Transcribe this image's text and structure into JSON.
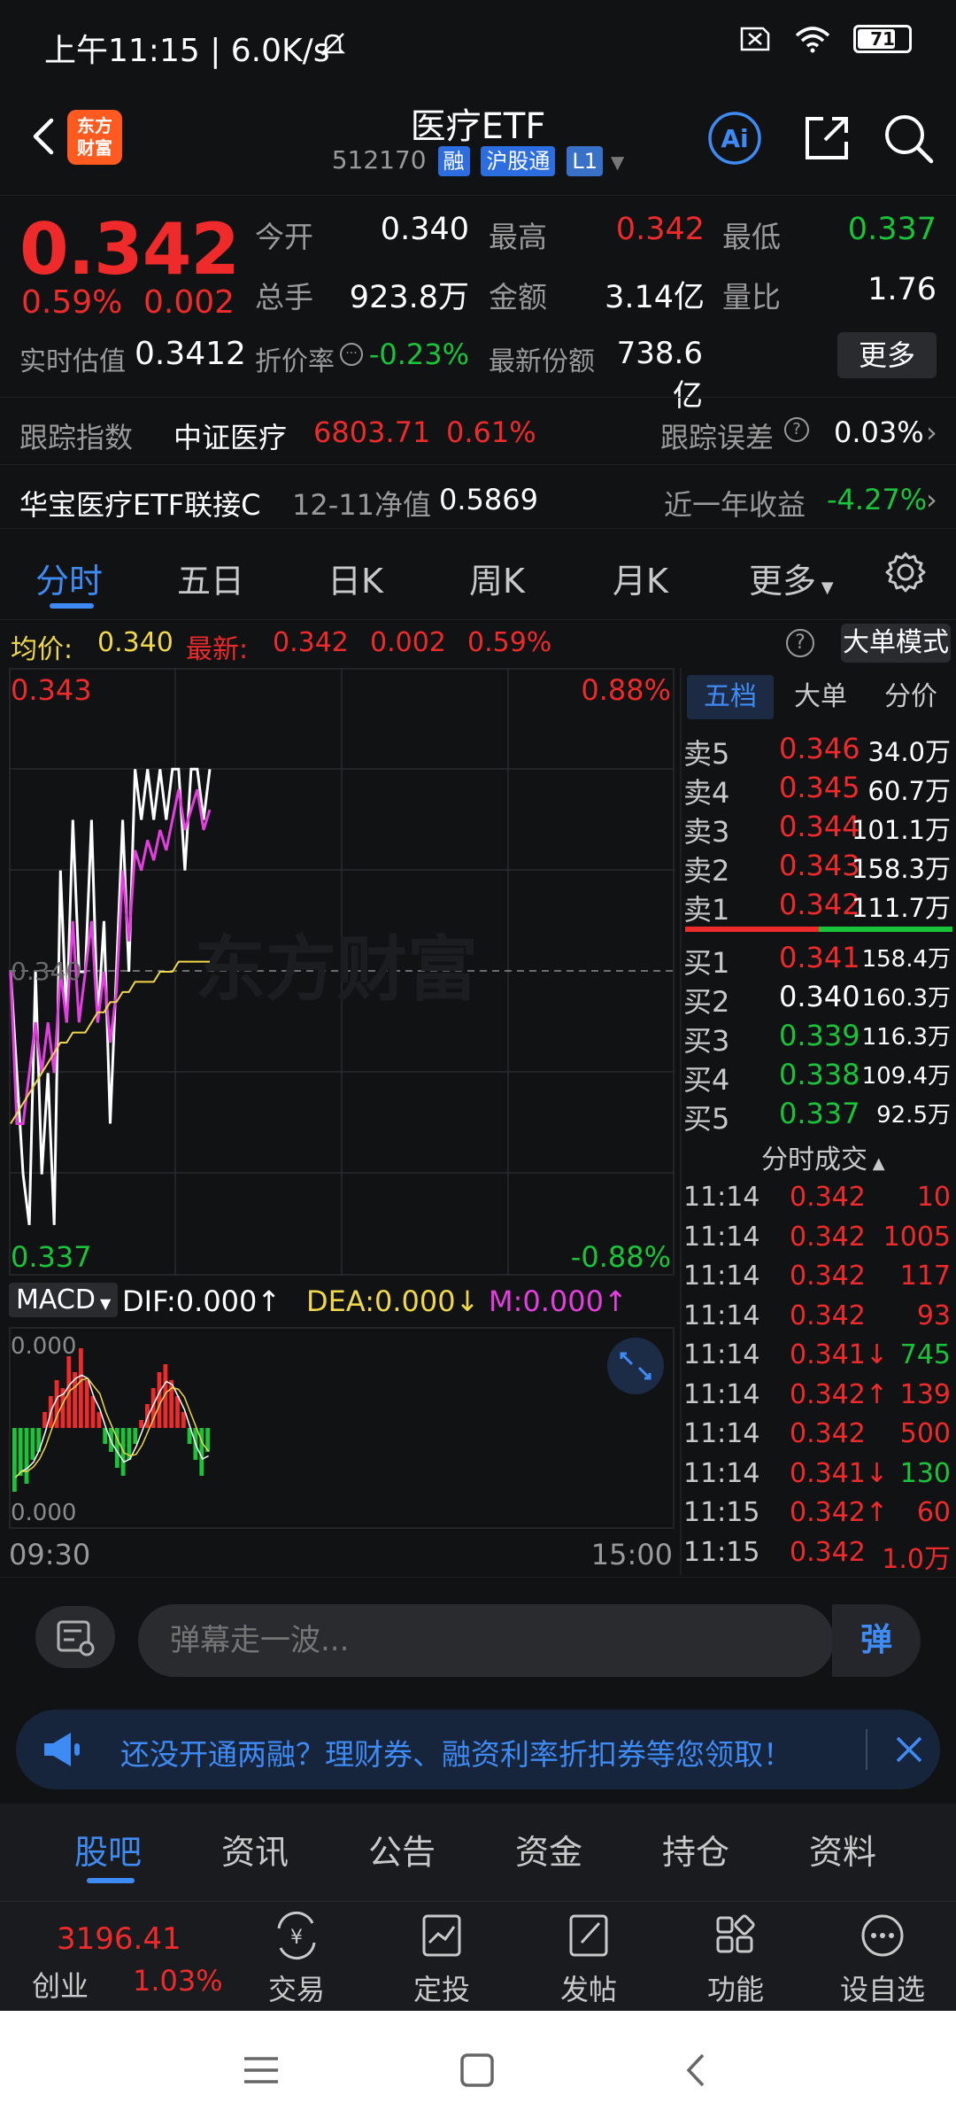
{
  "status": {
    "time": "上午11:15 | 6.0K/s",
    "battery": "71"
  },
  "header": {
    "logo_text": "东方\n财富",
    "title": "医疗ETF",
    "code": "512170",
    "tag_margin": "融",
    "tag_connect": "沪股通",
    "tag_level": "L1"
  },
  "quote": {
    "price": "0.342",
    "pct_change": "0.59%",
    "amt_change": "0.002",
    "open_label": "今开",
    "open": "0.340",
    "high_label": "最高",
    "high": "0.342",
    "low_label": "最低",
    "low": "0.337",
    "volume_label": "总手",
    "volume": "923.8万",
    "amount_label": "金额",
    "amount": "3.14亿",
    "ratio_label": "量比",
    "ratio": "1.76",
    "est_label": "实时估值",
    "est": "0.3412",
    "discount_label": "折价率",
    "discount": "-0.23%",
    "shares_label": "最新份额",
    "shares": "738.6亿",
    "more": "更多"
  },
  "tracking": {
    "index_label": "跟踪指数",
    "index_name": "中证医疗",
    "index_value": "6803.71",
    "index_pct": "0.61%",
    "error_label": "跟踪误差",
    "error_value": "0.03%",
    "link_fund": "华宝医疗ETF联接C",
    "nav_label": "12-11净值",
    "nav_value": "0.5869",
    "year_label": "近一年收益",
    "year_value": "-4.27%"
  },
  "chart_tabs": [
    "分时",
    "五日",
    "日K",
    "周K",
    "月K",
    "更多"
  ],
  "chart_info": {
    "avg_label": "均价:",
    "avg": "0.340",
    "latest_label": "最新:",
    "latest": "0.342",
    "chg": "0.002",
    "pct": "0.59%",
    "big_order": "大单模式"
  },
  "chart_labels": {
    "top_price": "0.343",
    "top_pct": "0.88%",
    "bottom_price": "0.337",
    "bottom_pct": "-0.88%",
    "ref_price": "0.340",
    "watermark": "东方财富",
    "start_time": "09:30",
    "end_time": "15:00"
  },
  "macd": {
    "name": "MACD",
    "dif": "DIF:0.000↑",
    "dea": "DEA:0.000↓",
    "m": "M:0.000↑",
    "top": "0.000",
    "bottom": "0.000"
  },
  "chart_data": [
    {
      "type": "line",
      "title": "",
      "ylim": [
        0.337,
        0.343
      ],
      "x": [
        "09:30",
        "15:00"
      ],
      "series": [
        {
          "name": "",
          "color": "#ffffff",
          "values": [
            0.34,
            0.339,
            0.338,
            0.3375,
            0.34,
            0.338,
            0.339,
            0.3375,
            0.341,
            0.3395,
            0.3415,
            0.34,
            0.34,
            0.3415,
            0.3395,
            0.3405,
            0.3385,
            0.34,
            0.3415,
            0.34,
            0.342,
            0.3415,
            0.342,
            0.3415,
            0.342,
            0.3415,
            0.342,
            0.342,
            0.341,
            0.342,
            0.342,
            0.3415,
            0.342
          ]
        },
        {
          "name": "",
          "color": "#e53ee0",
          "values": [
            0.34,
            0.3385,
            0.3385,
            0.339,
            0.3395,
            0.339,
            0.3395,
            0.339,
            0.34,
            0.3395,
            0.3405,
            0.3395,
            0.34,
            0.3405,
            0.3395,
            0.34,
            0.3393,
            0.3398,
            0.341,
            0.3403,
            0.3412,
            0.341,
            0.3413,
            0.3411,
            0.3414,
            0.3412,
            0.3415,
            0.3418,
            0.3414,
            0.3416,
            0.3418,
            0.3414,
            0.3416
          ]
        },
        {
          "name": "",
          "color": "#f1d84b",
          "values": [
            0.3385,
            0.3386,
            0.3387,
            0.3388,
            0.3389,
            0.339,
            0.3391,
            0.3392,
            0.3393,
            0.3393,
            0.3394,
            0.3394,
            0.3394,
            0.3395,
            0.3396,
            0.3396,
            0.3397,
            0.3397,
            0.3398,
            0.3398,
            0.3399,
            0.3399,
            0.3399,
            0.3399,
            0.34,
            0.34,
            0.34,
            0.3401,
            0.3401,
            0.3401,
            0.3401,
            0.3401,
            0.3401
          ]
        }
      ]
    },
    {
      "type": "bar",
      "title": "",
      "values": [
        -0.8,
        -0.6,
        -0.7,
        -0.4,
        -0.3,
        0.2,
        0.4,
        0.6,
        0.5,
        0.9,
        0.7,
        1.0,
        0.6,
        0.4,
        0.2,
        -0.2,
        -0.3,
        -0.5,
        -0.6,
        -0.4,
        -0.2,
        0.1,
        0.3,
        0.5,
        0.7,
        0.8,
        0.6,
        0.4,
        0.2,
        -0.2,
        -0.4,
        -0.6,
        -0.3
      ]
    }
  ],
  "orderbook": {
    "tabs": [
      "五档",
      "大单",
      "分价"
    ],
    "asks": [
      {
        "label": "卖5",
        "price": "0.346",
        "vol": "34.0万"
      },
      {
        "label": "卖4",
        "price": "0.345",
        "vol": "60.7万"
      },
      {
        "label": "卖3",
        "price": "0.344",
        "vol": "101.1万"
      },
      {
        "label": "卖2",
        "price": "0.343",
        "vol": "158.3万"
      },
      {
        "label": "卖1",
        "price": "0.342",
        "vol": "111.7万"
      }
    ],
    "bids": [
      {
        "label": "买1",
        "price": "0.341",
        "vol": "158.4万",
        "color": "#ef2a2a"
      },
      {
        "label": "买2",
        "price": "0.340",
        "vol": "160.3万",
        "color": "#ffffff"
      },
      {
        "label": "买3",
        "price": "0.339",
        "vol": "116.3万",
        "color": "#19c43a"
      },
      {
        "label": "买4",
        "price": "0.338",
        "vol": "109.4万",
        "color": "#19c43a"
      },
      {
        "label": "买5",
        "price": "0.337",
        "vol": "92.5万",
        "color": "#19c43a"
      }
    ],
    "ticks_title": "分时成交",
    "ticks": [
      {
        "time": "11:14",
        "price": "0.342",
        "vol": "10",
        "pcolor": "#ef2a2a",
        "vcolor": "#ef2a2a"
      },
      {
        "time": "11:14",
        "price": "0.342",
        "vol": "1005",
        "pcolor": "#ef2a2a",
        "vcolor": "#ef2a2a"
      },
      {
        "time": "11:14",
        "price": "0.342",
        "vol": "117",
        "pcolor": "#ef2a2a",
        "vcolor": "#ef2a2a"
      },
      {
        "time": "11:14",
        "price": "0.342",
        "vol": "93",
        "pcolor": "#ef2a2a",
        "vcolor": "#ef2a2a"
      },
      {
        "time": "11:14",
        "price": "0.341↓",
        "vol": "745",
        "pcolor": "#ef2a2a",
        "vcolor": "#19c43a"
      },
      {
        "time": "11:14",
        "price": "0.342↑",
        "vol": "139",
        "pcolor": "#ef2a2a",
        "vcolor": "#ef2a2a"
      },
      {
        "time": "11:14",
        "price": "0.342",
        "vol": "500",
        "pcolor": "#ef2a2a",
        "vcolor": "#ef2a2a"
      },
      {
        "time": "11:14",
        "price": "0.341↓",
        "vol": "130",
        "pcolor": "#ef2a2a",
        "vcolor": "#19c43a"
      },
      {
        "time": "11:15",
        "price": "0.342↑",
        "vol": "60",
        "pcolor": "#ef2a2a",
        "vcolor": "#ef2a2a"
      },
      {
        "time": "11:15",
        "price": "0.342",
        "vol": "1.0万",
        "pcolor": "#ef2a2a",
        "vcolor": "#ef2a2a"
      }
    ]
  },
  "comment": {
    "placeholder": "弹幕走一波...",
    "danmu": "弹"
  },
  "promo": {
    "text": "还没开通两融？理财券、融资利率折扣券等您领取！"
  },
  "content_tabs": [
    "股吧",
    "资讯",
    "公告",
    "资金",
    "持仓",
    "资料"
  ],
  "toolbar": {
    "index_value": "3196.41",
    "index_name": "创业",
    "index_pct": "1.03%",
    "items": [
      "交易",
      "定投",
      "发帖",
      "功能",
      "设自选"
    ]
  },
  "colors": {
    "up": "#ef2a2a",
    "down": "#19c43a",
    "accent": "#3e8bf5",
    "bg": "#111214"
  }
}
